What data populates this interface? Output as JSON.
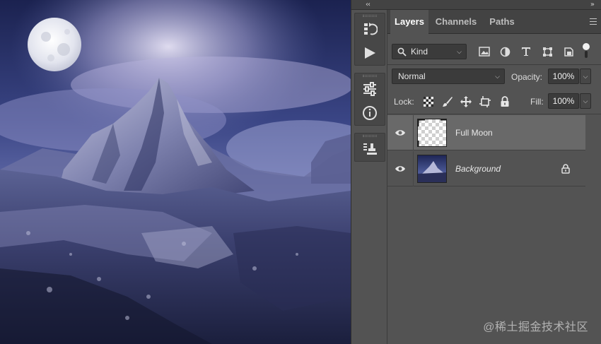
{
  "panel": {
    "tabs": [
      {
        "label": "Layers",
        "active": true
      },
      {
        "label": "Channels",
        "active": false
      },
      {
        "label": "Paths",
        "active": false
      }
    ],
    "filter": {
      "type_label": "Kind",
      "filter_icons": [
        "image-filter-icon",
        "adjustment-filter-icon",
        "type-filter-icon",
        "shape-filter-icon",
        "smart-object-filter-icon",
        "filter-toggle-icon"
      ]
    },
    "blend_mode": "Normal",
    "opacity_label": "Opacity:",
    "opacity_value": "100%",
    "lock_label": "Lock:",
    "lock_icons": [
      "lock-transparent-pixels-icon",
      "lock-image-pixels-icon",
      "lock-position-icon",
      "lock-artboard-icon",
      "lock-all-icon"
    ],
    "fill_label": "Fill:",
    "fill_value": "100%",
    "layers": [
      {
        "name": "Full Moon",
        "selected": true,
        "visible": true,
        "locked": false,
        "italic": false
      },
      {
        "name": "Background",
        "selected": false,
        "visible": true,
        "locked": true,
        "italic": true
      }
    ]
  },
  "toolstrip": {
    "tools": [
      "history-icon",
      "actions-play-icon",
      "adjustments-icon",
      "info-icon",
      "clone-source-icon"
    ]
  },
  "watermark": "@稀土掘金技术社区",
  "colors": {
    "panel_bg": "#535353",
    "selected_layer": "#696969",
    "tab_bar": "#434343"
  }
}
